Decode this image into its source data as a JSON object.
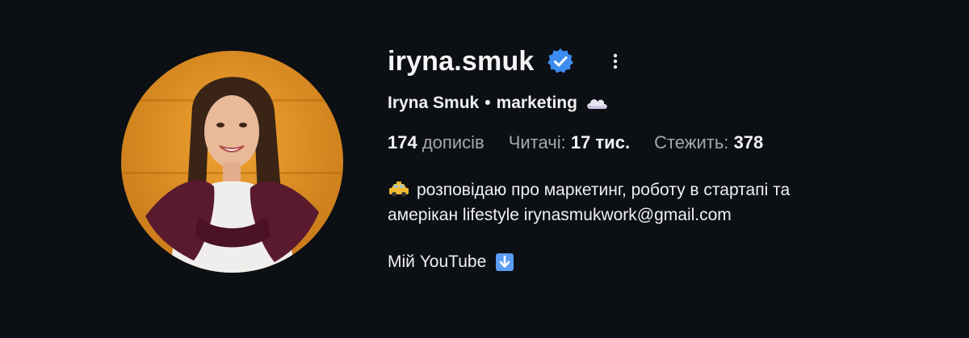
{
  "profile": {
    "username": "iryna.smuk",
    "verified": true,
    "full_name": "Iryna Smuk",
    "separator": "•",
    "category": "marketing",
    "stats": {
      "posts_count": "174",
      "posts_label": "дописів",
      "followers_label": "Читачі:",
      "followers_count": "17 тис.",
      "following_label": "Стежить:",
      "following_count": "378"
    },
    "bio_line1": "розповідаю про маркетинг, роботу в стартапі та",
    "bio_line2": "амерікан lifestyle irynasmukwork@gmail.com",
    "youtube_text": "Мій YouTube"
  },
  "icons": {
    "verified": "verified-badge-icon",
    "more": "more-options-icon",
    "cloud": "cloud-icon",
    "taxi": "taxi-icon",
    "down_arrow": "down-arrow-icon"
  },
  "colors": {
    "background": "#0c0f14",
    "verified_blue": "#3d8cf0",
    "text_primary": "#f5f5f5",
    "text_secondary": "#a8a8a8"
  }
}
